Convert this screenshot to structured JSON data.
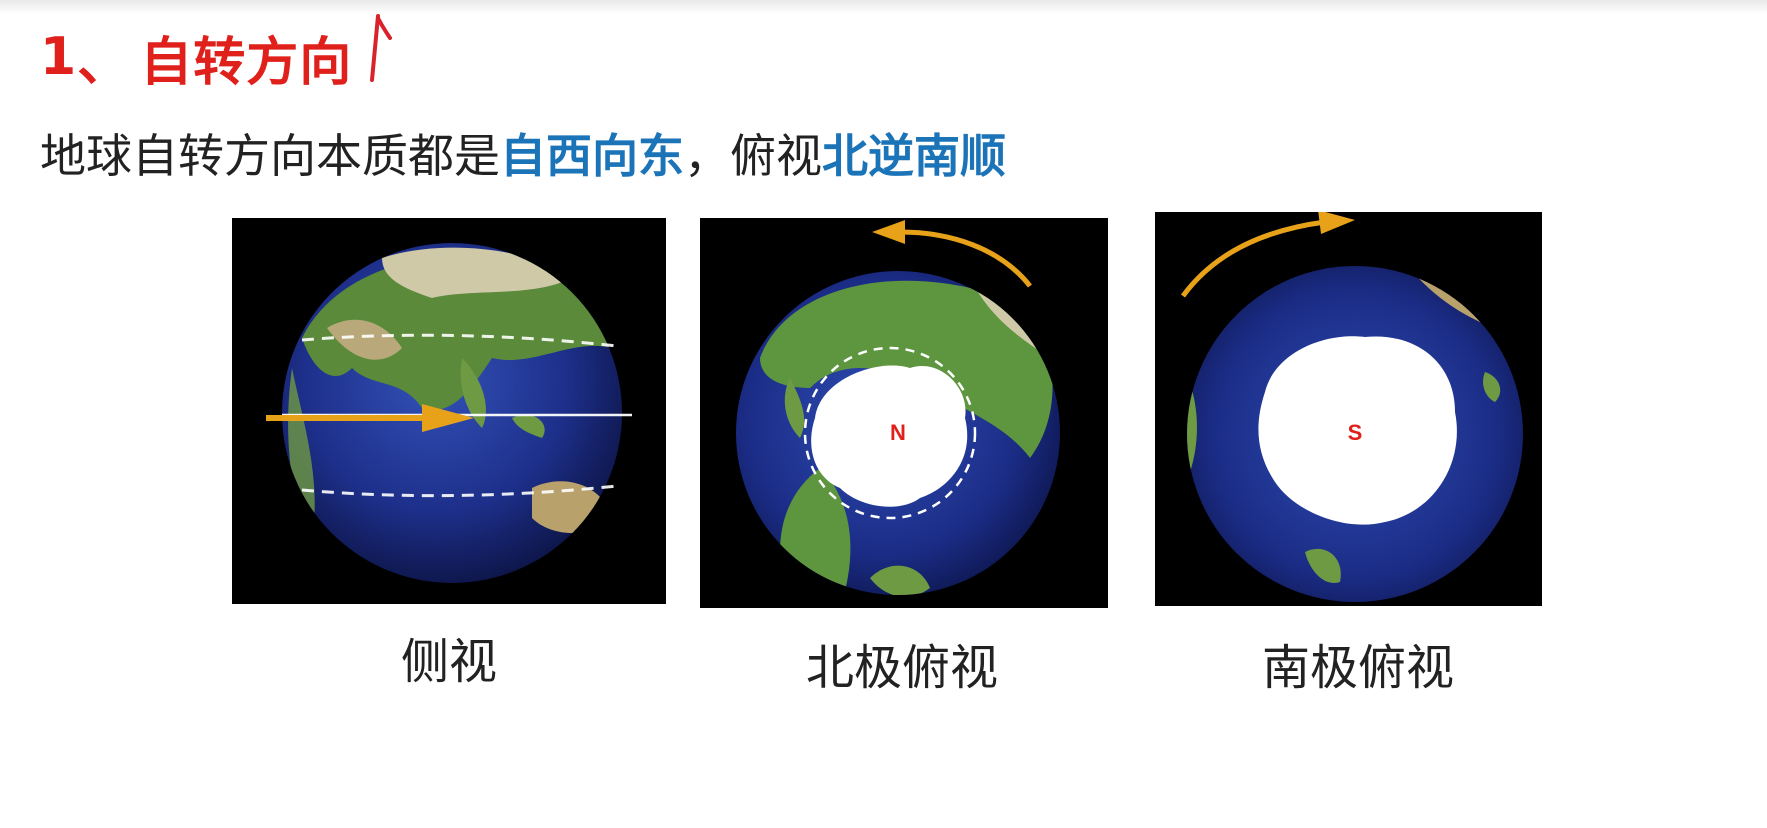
{
  "heading": {
    "number": "1",
    "separator": "、",
    "title": "自转方向"
  },
  "statement": {
    "prefix": "地球自转方向本质都是",
    "highlight1": "自西向东",
    "middle": "，俯视",
    "highlight2": "北逆南顺"
  },
  "panels": [
    {
      "caption": "侧视",
      "pole_label": ""
    },
    {
      "caption": "北极俯视",
      "pole_label": "N"
    },
    {
      "caption": "南极俯视",
      "pole_label": "S"
    }
  ],
  "colors": {
    "heading_red": "#e0201b",
    "highlight_blue": "#1b73b8",
    "arrow_orange": "#e8a21a",
    "pole_label_red": "#e0201b"
  }
}
